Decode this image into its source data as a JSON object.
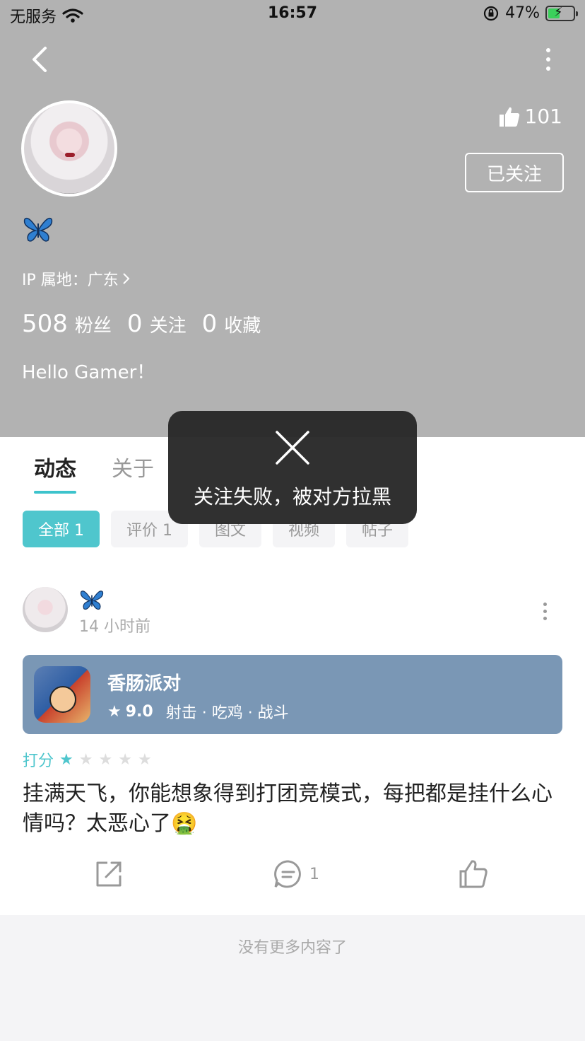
{
  "status_bar": {
    "carrier": "无服务",
    "time": "16:57",
    "battery": "47%"
  },
  "profile": {
    "likes": "101",
    "follow_label": "已关注",
    "ip": "IP 属地：广东",
    "stats": [
      {
        "num": "508",
        "label": "粉丝"
      },
      {
        "num": "0",
        "label": "关注"
      },
      {
        "num": "0",
        "label": "收藏"
      }
    ],
    "bio": "Hello Gamer！"
  },
  "tabs": [
    "动态",
    "关于"
  ],
  "filters": [
    "全部 1",
    "评价 1",
    "图文",
    "视频",
    "帖子"
  ],
  "post": {
    "time": "14 小时前",
    "game": {
      "title": "香肠派对",
      "score": "9.0",
      "tags": "射击 · 吃鸡 · 战斗"
    },
    "rating_label": "打分",
    "rating_value": 1,
    "text": "挂满天飞，你能想象得到打团竞模式，每把都是挂什么心情吗？太恶心了🤮",
    "comment_count": "1"
  },
  "footer_text": "没有更多内容了",
  "toast": {
    "message": "关注失败，被对方拉黑"
  },
  "colors": {
    "accent": "#4fc6cd",
    "header_bg": "#b2b2b2",
    "game_card": "#7a97b5"
  }
}
